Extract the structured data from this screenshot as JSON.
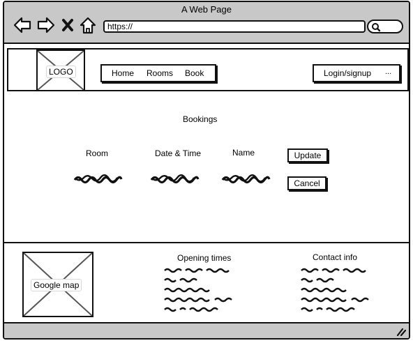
{
  "window": {
    "title": "A Web Page"
  },
  "browser": {
    "url": "https://",
    "back_icon": "back-arrow-icon",
    "forward_icon": "forward-arrow-icon",
    "stop_icon": "close-icon",
    "home_icon": "home-icon",
    "search_icon": "search-icon"
  },
  "header": {
    "logo": "LOGO",
    "nav": [
      "Home",
      "Rooms",
      "Book"
    ],
    "login": "Login/signup",
    "more": "..."
  },
  "main": {
    "title": "Bookings",
    "columns": [
      "Room",
      "Date & Time",
      "Name"
    ],
    "update_label": "Update",
    "cancel_label": "Cancel"
  },
  "footer": {
    "map_label": "Google map",
    "opening_title": "Opening times",
    "contact_title": "Contact info"
  },
  "colors": {
    "chrome": "#c8c8c8",
    "ink": "#111111"
  }
}
